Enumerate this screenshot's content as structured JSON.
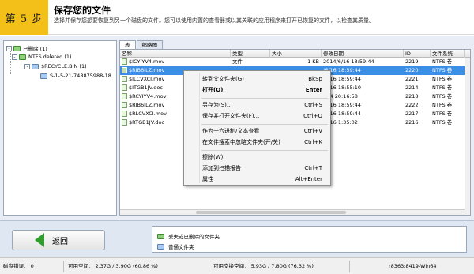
{
  "header": {
    "step_label": "第 5 步",
    "title": "保存您的文件",
    "description": "选择并保存您想要恢复到另一个磁盘的文件。您可以使用内置的查看器或以其关联的应用程序来打开已恢复的文件，以检查其质量。"
  },
  "tree": {
    "items": [
      {
        "label": "已删除 (1)"
      },
      {
        "label": "NTFS deleted (1)"
      },
      {
        "label": "$RECYCLE.BIN (1)"
      },
      {
        "label": "S-1-5-21-748875988-18"
      }
    ]
  },
  "tabs": [
    {
      "label": "表"
    },
    {
      "label": "缩略图"
    }
  ],
  "columns": [
    "名称",
    "类型",
    "大小",
    "修改日期",
    "ID",
    "文件系统"
  ],
  "rows": [
    {
      "name": "$ICYIYV4.mov",
      "type": "文件",
      "size": "1 KB",
      "date": "2014/6/16 18:59:44",
      "id": "2219",
      "fs": "NTFS 卷"
    },
    {
      "name": "$RIB6ILZ.mov",
      "type": "",
      "size": "",
      "date": "/6/16 18:59:44",
      "id": "2220",
      "fs": "NTFS 卷"
    },
    {
      "name": "$ILCVXCI.mov",
      "type": "",
      "size": "",
      "date": "/6/16 18:59:44",
      "id": "2221",
      "fs": "NTFS 卷"
    },
    {
      "name": "$ITGB1JV.doc",
      "type": "",
      "size": "",
      "date": "/6/16 18:55:10",
      "id": "2214",
      "fs": "NTFS 卷"
    },
    {
      "name": "$RCYIYV4.mov",
      "type": "",
      "size": "",
      "date": "/8/4 20:16:58",
      "id": "2218",
      "fs": "NTFS 卷"
    },
    {
      "name": "$RIB6ILZ.mov",
      "type": "",
      "size": "",
      "date": "/6/16 18:59:44",
      "id": "2222",
      "fs": "NTFS 卷"
    },
    {
      "name": "$RLCVXCI.mov",
      "type": "",
      "size": "",
      "date": "/6/16 18:59:44",
      "id": "2217",
      "fs": "NTFS 卷"
    },
    {
      "name": "$RTGB1JV.doc",
      "type": "",
      "size": "",
      "date": "/4/16 1:35:02",
      "id": "2216",
      "fs": "NTFS 卷"
    }
  ],
  "context_menu": {
    "items": [
      {
        "label": "转到父文件夹(G)",
        "key": "BkSp"
      },
      {
        "label": "打开(O)",
        "key": "Enter"
      },
      {
        "label": "另存为(S)...",
        "key": "Ctrl+S"
      },
      {
        "label": "保存并打开文件夹(F)...",
        "key": "Ctrl+O"
      },
      {
        "label": "作为十六进制/文本查看",
        "key": "Ctrl+V"
      },
      {
        "label": "在文件搜索中忽略文件夹(开/关)",
        "key": "Ctrl+K"
      },
      {
        "label": "擦除(W)",
        "key": ""
      },
      {
        "label": "添加到扫描报告",
        "key": "Ctrl+T"
      },
      {
        "label": "属性",
        "key": "Alt+Enter"
      }
    ]
  },
  "bottom": {
    "back_label": "返回",
    "legend": [
      {
        "label": "丢失或已删除的文件夹"
      },
      {
        "label": "普通文件夹"
      }
    ]
  },
  "status": {
    "disk_errors": "磁盘错误： 0",
    "free_space": "可用空间： 2.37G / 3.90G (60.86 %)",
    "free_swap": "可用交换空间： 5.93G / 7.80G (76.32 %)",
    "build": "r8363:8419-Win64"
  },
  "colors": {
    "step_badge": "#f3c01a",
    "selection": "#3a8ee6",
    "back_arrow": "#2f9e2a"
  }
}
